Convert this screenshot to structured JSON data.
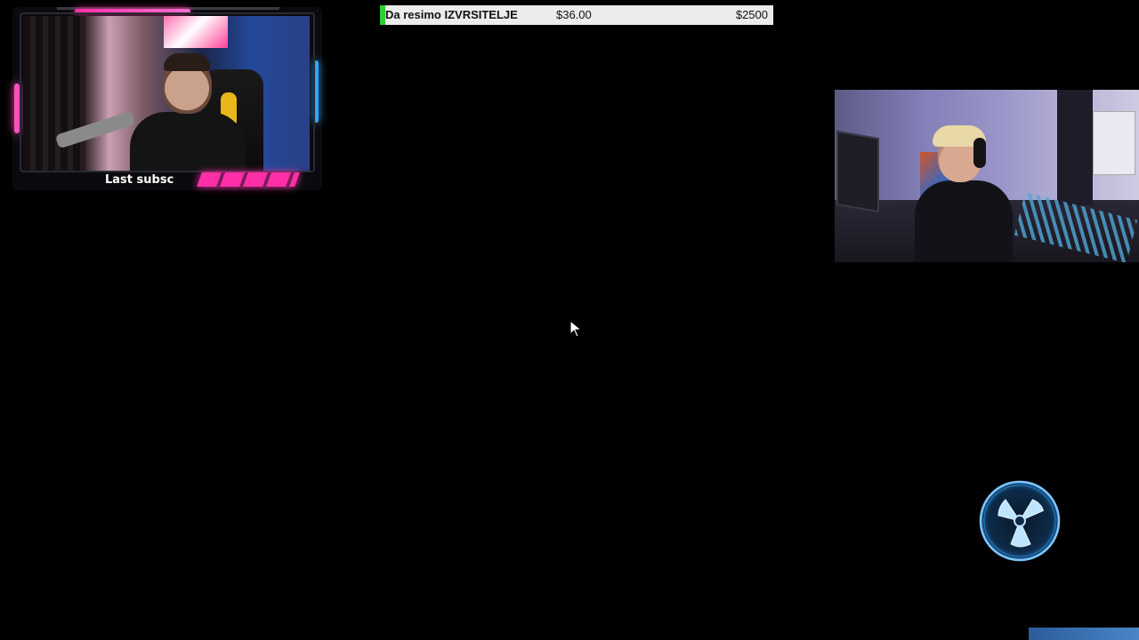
{
  "streamer_cam": {
    "ticker_label": "Last subsc"
  },
  "goal": {
    "name": "Da resimo IZVRSITELJE",
    "current": "$36.00",
    "target": "$2500",
    "progress_fraction": 0.0144,
    "fill_color": "#2fd02f",
    "bar_color": "#ececec"
  },
  "colors": {
    "accent_pink": "#ff2fa8",
    "accent_blue": "#2fa6ff",
    "fan_glow": "#2f9ee8"
  },
  "icons": {
    "cursor": "mouse-pointer-icon",
    "fan": "fan-icon"
  }
}
